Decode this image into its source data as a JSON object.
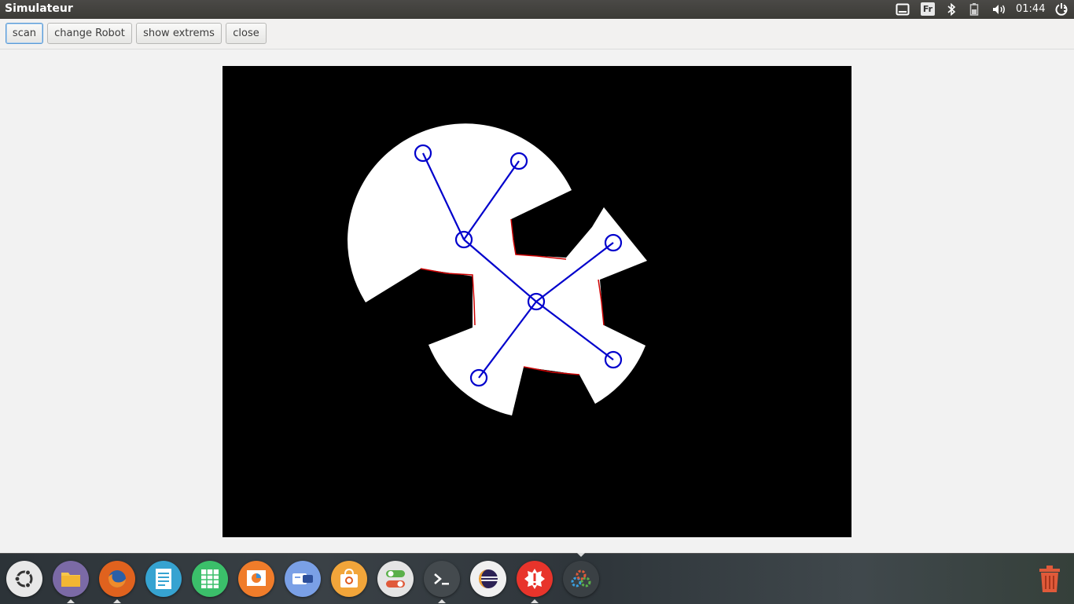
{
  "window": {
    "title": "Simulateur"
  },
  "tray": {
    "keyboard_layout": "Fr",
    "clock": "01:44"
  },
  "toolbar": {
    "scan_label": "scan",
    "change_robot_label": "change Robot",
    "show_extrems_label": "show extrems",
    "close_label": "close"
  },
  "canvas": {
    "background": "#000000",
    "free_space_color": "#ffffff",
    "robot_color": "#0000cc",
    "obstacle_edge_color": "#cc0000"
  },
  "dock": {
    "items": [
      {
        "icon": "ubuntu-logo-icon",
        "color": "#e8e8e8"
      },
      {
        "icon": "files-icon",
        "color": "#7b6aa6"
      },
      {
        "icon": "firefox-icon",
        "color": "#e0621e"
      },
      {
        "icon": "text-editor-icon",
        "color": "#36a3d1"
      },
      {
        "icon": "spreadsheet-icon",
        "color": "#3bbf6a"
      },
      {
        "icon": "presentation-icon",
        "color": "#f07c2a"
      },
      {
        "icon": "switcher-icon",
        "color": "#7aa0e6"
      },
      {
        "icon": "software-center-icon",
        "color": "#f2a53a"
      },
      {
        "icon": "settings-toggle-icon",
        "color": "#e4e4e4"
      },
      {
        "icon": "terminal-icon",
        "color": "#444a4e"
      },
      {
        "icon": "eclipse-icon",
        "color": "#f0f0f0"
      },
      {
        "icon": "update-alert-icon",
        "color": "#e8342b"
      },
      {
        "icon": "gears-icon",
        "color": "#3a4044"
      },
      {
        "icon": "trash-icon",
        "color": "#e05a3a"
      }
    ]
  }
}
